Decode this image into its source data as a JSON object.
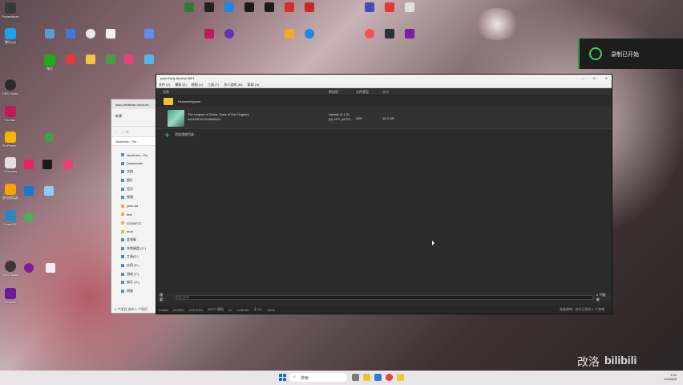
{
  "desktop_icons": [
    {
      "label": "Pubsettload",
      "color": "#3a3a3a"
    },
    {
      "label": "腾讯QQ",
      "color": "#1aa1e8"
    },
    {
      "label": "微信",
      "color": "#1aad19"
    },
    {
      "label": "OBS Studio",
      "color": "#2b2b2b"
    },
    {
      "label": "Tutorial...",
      "color": "#c2185b"
    },
    {
      "label": "ProPlayer...",
      "color": "#f4b400"
    },
    {
      "label": "CCleaner",
      "color": "#e0e0e0"
    },
    {
      "label": "雷电模拟器",
      "color": "#f7a400"
    },
    {
      "label": "ClearHDR",
      "color": "#2e86c1"
    },
    {
      "label": "OBS Studio",
      "color": "#3a3a3a"
    },
    {
      "label": "VMware",
      "color": "#6a1b9a"
    }
  ],
  "notification": {
    "text": "录制已开始"
  },
  "explorer": {
    "tab_title": "yuzu-windows-msvc-ea",
    "toolbar_label": "新建",
    "address": "OneDrive - Per",
    "tree": [
      "OneDrive - Per",
      "Downloads",
      "文档",
      "图片",
      "音乐",
      "视频",
      "yuzu-ea",
      "test",
      "01006F2C",
      "mod",
      "此电脑",
      "本地磁盘 (C:)",
      "工具(D:)",
      "应用 (E:)",
      "游戏 (F:)",
      "娱乐 (G:)",
      "网络"
    ],
    "status": "2 个项目  选中 1 个项目"
  },
  "yuzu": {
    "title": "yuzu Early Access 3821",
    "window_controls": [
      "—",
      "☐",
      "✕"
    ],
    "menu": [
      "文件 (F)",
      "模拟 (E)",
      "视图 (V)",
      "工具 (T)",
      "多人游戏 (M)",
      "帮助 (H)"
    ],
    "columns": [
      "名称",
      "附加项",
      "文件类型",
      "大小"
    ],
    "folder": "Hs\\switch\\game",
    "game": {
      "title": "The Legend of Zelda: Tears of the Kingdom",
      "id": "0x0100F2C0115B6000",
      "addons": "Update (1.1.2)\n[D] VFP_AUTO...",
      "type": "NSP",
      "size": "16.3 GB"
    },
    "add_label": "添加游戏目录",
    "filter_label": "搜索：",
    "filter_placeholder": "搜索名称",
    "filter_count": "1 个结果",
    "status": [
      "Vulkan",
      "NVDEC",
      "DOCKED",
      "ASTC 模拟",
      "2X",
      "LINEAR",
      "无 AA",
      "100%"
    ],
    "status_right": "准备就绪 · 总共已找到 1 个游戏"
  },
  "watermark": [
    "改洛",
    "bilibili"
  ],
  "taskbar": {
    "search_placeholder": "搜索",
    "time": "1:34",
    "date": "2023/6/9"
  }
}
